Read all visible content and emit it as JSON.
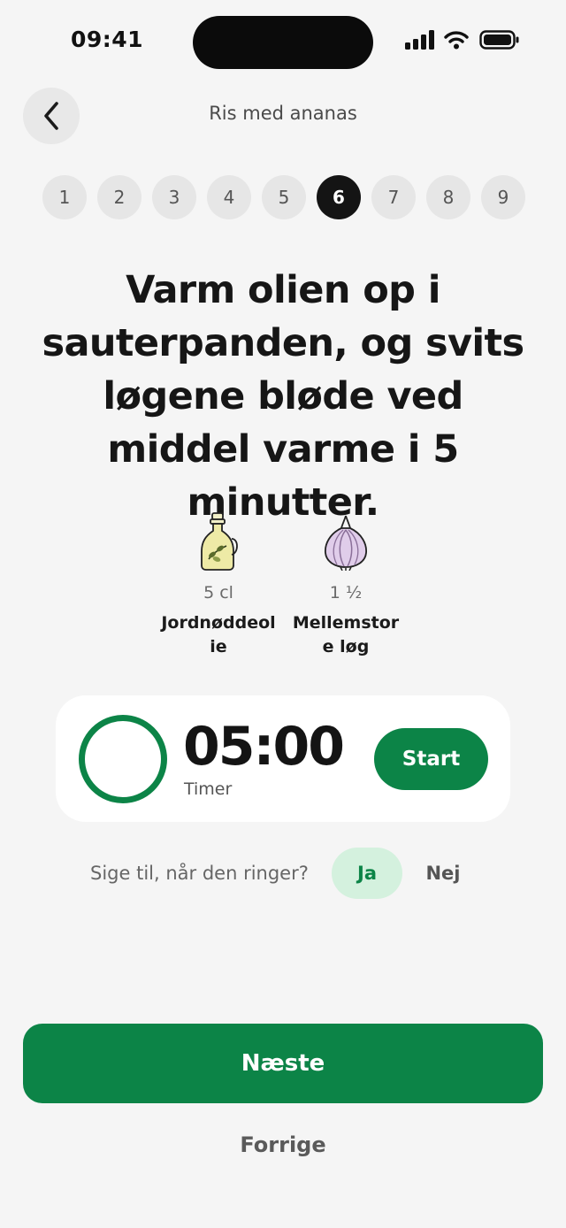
{
  "status_bar": {
    "time": "09:41",
    "icons": [
      "signal-icon",
      "wifi-icon",
      "battery-icon"
    ]
  },
  "header": {
    "title": "Ris med ananas",
    "back_icon": "chevron-left-icon"
  },
  "steps": {
    "items": [
      "1",
      "2",
      "3",
      "4",
      "5",
      "6",
      "7",
      "8",
      "9"
    ],
    "current": "6"
  },
  "instruction": "Varm olien op i sauterpanden, og svits løgene bløde ved middel varme i 5 minutter.",
  "ingredients": [
    {
      "icon": "oil-bottle-icon",
      "amount": "5 cl",
      "name": "Jordnøddeolie"
    },
    {
      "icon": "onion-icon",
      "amount": "1 ½",
      "name": "Mellemstore løg"
    }
  ],
  "timer": {
    "value": "05:00",
    "label": "Timer",
    "start_label": "Start",
    "progress": 0
  },
  "notify": {
    "question": "Sige til, når den ringer?",
    "yes_label": "Ja",
    "no_label": "Nej",
    "selected": "Ja"
  },
  "actions": {
    "next_label": "Næste",
    "prev_label": "Forrige"
  },
  "colors": {
    "accent": "#0c8447",
    "accent_light": "#d4f1de",
    "background": "#f5f5f5"
  }
}
